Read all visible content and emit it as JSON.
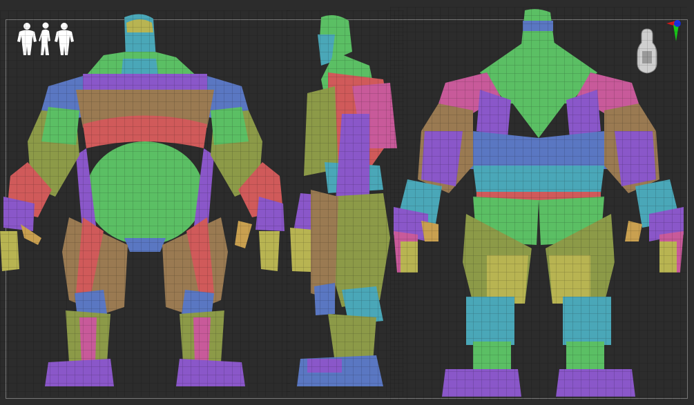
{
  "viewport": {
    "views": [
      "front",
      "side",
      "back"
    ]
  },
  "colors": {
    "background": "#2c2c2c",
    "frame": "#777777",
    "polygroup_green": "#5bbf64",
    "polygroup_purple": "#8a57c9",
    "polygroup_blue": "#5a77c2",
    "polygroup_red": "#d05a5a",
    "polygroup_brown": "#9a7a52",
    "polygroup_olive": "#8c9a48",
    "polygroup_cyan": "#4aa7b8",
    "polygroup_yellow": "#b8b452",
    "polygroup_pink": "#c85a9a",
    "axis_red": "#e01818",
    "axis_green": "#18c818",
    "axis_blue": "#1830e0"
  },
  "icons": {
    "view_icon": "three-figure-silhouette-icon",
    "gizmo": "axis-orientation-gizmo-icon"
  }
}
